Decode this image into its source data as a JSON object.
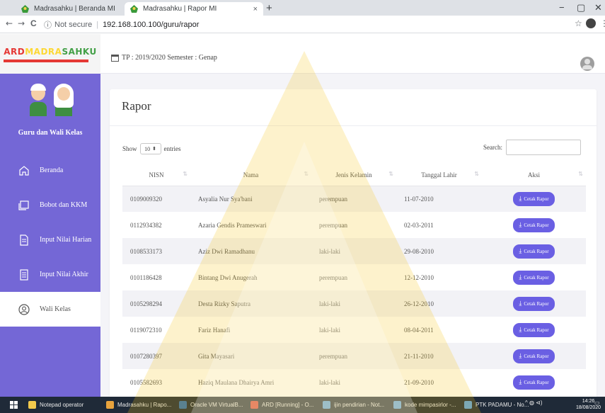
{
  "browser": {
    "tabs": [
      {
        "title": "Madrasahku | Beranda MI",
        "active": false
      },
      {
        "title": "Madrasahku | Rapor MI",
        "active": true
      }
    ],
    "new_tab_glyph": "+",
    "tab_close_glyph": "×",
    "window_controls": {
      "minimize": "−",
      "maximize": "▢",
      "close": "✕"
    },
    "nav": {
      "back": "←",
      "forward": "→",
      "reload": "C"
    },
    "security_label": "Not secure",
    "url": "192.168.100.100/guru/rapor"
  },
  "header": {
    "logo_parts": [
      "ARD",
      "MADRA",
      "SAHKU"
    ],
    "academic_period": "TP : 2019/2020  Semester : Genap"
  },
  "sidebar": {
    "profile_name": "Guru dan Wali Kelas",
    "items": [
      {
        "label": "Beranda",
        "icon": "home-icon"
      },
      {
        "label": "Bobot dan KKM",
        "icon": "window-icon"
      },
      {
        "label": "Input Nilai Harian",
        "icon": "document-icon"
      },
      {
        "label": "Input Nilai Akhir",
        "icon": "document-lines-icon"
      },
      {
        "label": "Wali Kelas",
        "icon": "user-circle-icon",
        "active": true
      }
    ]
  },
  "page": {
    "title": "Rapor",
    "show_label": "Show",
    "entries_value": "10",
    "entries_label": "entries",
    "search_label": "Search:",
    "search_value": ""
  },
  "table": {
    "columns": [
      "NISN",
      "Nama",
      "Jenis Kelamin",
      "Tanggal Lahir",
      "Aksi"
    ],
    "action_label": "Cetak Rapor",
    "rows": [
      {
        "nisn": "0109009320",
        "nama": "Asyalia Nur Sya'bani",
        "jk": "perempuan",
        "tgl": "11-07-2010"
      },
      {
        "nisn": "0112934382",
        "nama": "Azaria Gendis Prameswari",
        "jk": "perempuan",
        "tgl": "02-03-2011"
      },
      {
        "nisn": "0108533173",
        "nama": "Aziz Dwi Ramadhanu",
        "jk": "laki-laki",
        "tgl": "29-08-2010"
      },
      {
        "nisn": "0101186428",
        "nama": "Bintang Dwi Anugerah",
        "jk": "perempuan",
        "tgl": "12-12-2010"
      },
      {
        "nisn": "0105298294",
        "nama": "Desta Rizky Saputra",
        "jk": "laki-laki",
        "tgl": "26-12-2010"
      },
      {
        "nisn": "0119072310",
        "nama": "Fariz Hanafi",
        "jk": "laki-laki",
        "tgl": "08-04-2011"
      },
      {
        "nisn": "0107280397",
        "nama": "Gita Mayasari",
        "jk": "perempuan",
        "tgl": "21-11-2010"
      },
      {
        "nisn": "0105582693",
        "nama": "Haziq Maulana Dhairya Amri",
        "jk": "laki-laki",
        "tgl": "21-09-2010"
      }
    ]
  },
  "taskbar": {
    "items": [
      {
        "label": "Notepad operator",
        "color": "#f2c94c"
      },
      {
        "label": "Madrasahku | Rapo...",
        "color": "#e8a33d"
      },
      {
        "label": "Oracle VM VirtualB...",
        "color": "#2f6fb3"
      },
      {
        "label": "ARD [Running] - O...",
        "color": "#d9443a"
      },
      {
        "label": "ijin pendirian - Not...",
        "color": "#5aa0e0"
      },
      {
        "label": "kode mimpasirlor -...",
        "color": "#5aa0e0"
      },
      {
        "label": "PTK PADAMU - No...",
        "color": "#5aa0e0"
      }
    ],
    "tray": "^  ◍  ⊲)",
    "time": "14:26",
    "date": "18/08/2020"
  },
  "colors": {
    "sidebar": "#7467d6",
    "button": "#6a5fe3",
    "watermark": "#f5c518"
  }
}
